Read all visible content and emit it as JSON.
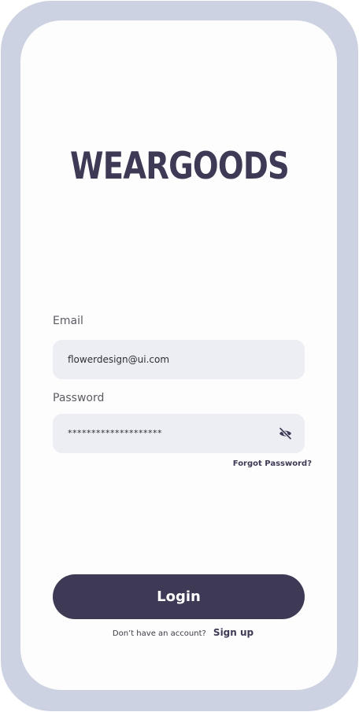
{
  "brand": {
    "logo_text": "WEARGOODS"
  },
  "login_form": {
    "email_label": "Email",
    "email_value": "flowerdesign@ui.com",
    "password_label": "Password",
    "password_value": "********************",
    "password_visibility_icon": "eye-slash-icon",
    "forgot_password_label": "Forgot Password?",
    "login_button_label": "Login"
  },
  "signup": {
    "prompt": "Don’t have an account?",
    "link_label": "Sign up"
  },
  "colors": {
    "frame": "#ccd2e2",
    "screen": "#fdfdfd",
    "accent": "#3e3955",
    "field_background": "#eceef3"
  }
}
